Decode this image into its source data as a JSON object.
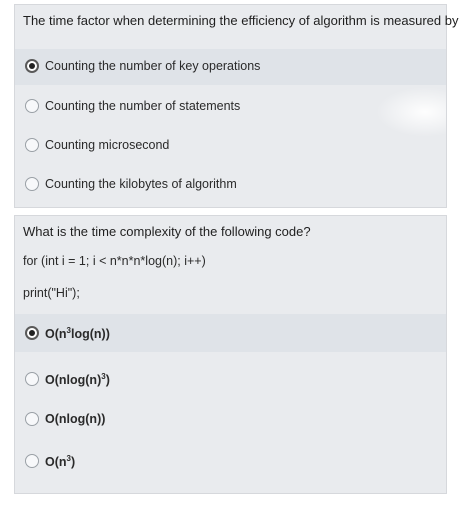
{
  "question1": {
    "prompt": "The time factor when determining the efficiency of algorithm is measured by",
    "options": [
      {
        "label": "Counting the number of key operations",
        "selected": true
      },
      {
        "label": "Counting the number of statements",
        "selected": false
      },
      {
        "label": "Counting microsecond",
        "selected": false
      },
      {
        "label": "Counting the kilobytes of algorithm",
        "selected": false
      }
    ]
  },
  "question2": {
    "prompt": "What is the time complexity of the following code?",
    "code_line1": "for (int i = 1; i < n*n*n*log(n); i++)",
    "code_line2": "print(\"Hi\");",
    "options": [
      {
        "pre": "O(n",
        "sup": "3",
        "post": "log(n))",
        "selected": true
      },
      {
        "pre": "O(nlog(n)",
        "sup": "3",
        "post": ")",
        "selected": false
      },
      {
        "pre": "O(nlog(n))",
        "sup": "",
        "post": "",
        "selected": false
      },
      {
        "pre": "O(n",
        "sup": "3",
        "post": ")",
        "selected": false
      }
    ]
  }
}
